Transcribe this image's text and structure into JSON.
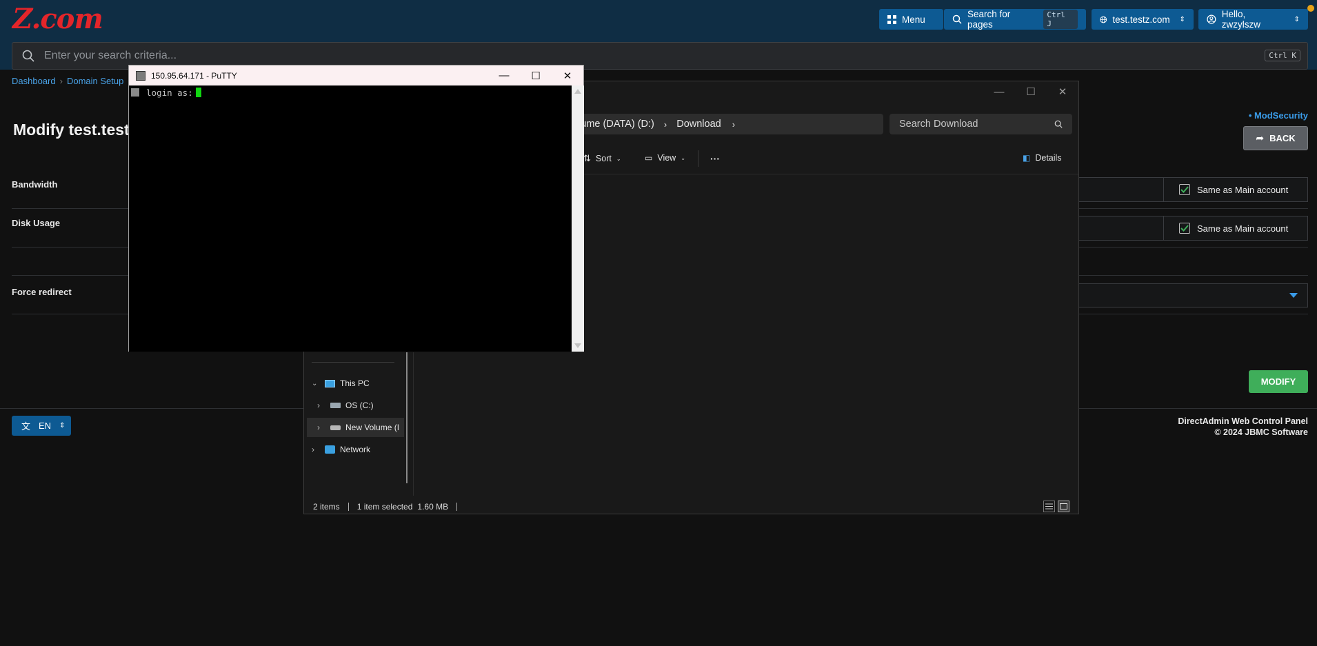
{
  "header": {
    "logo": "Z.com",
    "menu_label": "Menu",
    "search_pages_label": "Search for pages",
    "search_pages_shortcut": "Ctrl J",
    "domain_label": "test.testz.com",
    "user_label": "Hello, zwzylszw"
  },
  "search": {
    "placeholder": "Enter your search criteria...",
    "shortcut": "Ctrl K"
  },
  "breadcrumb": [
    "Dashboard",
    "Domain Setup"
  ],
  "page": {
    "title": "Modify test.test",
    "modsecurity_link": "• ModSecurity",
    "back_label": "BACK",
    "modify_label": "MODIFY"
  },
  "form": {
    "bandwidth_label": "Bandwidth",
    "disk_usage_label": "Disk Usage",
    "force_redirect_label": "Force redirect",
    "same_as_main": "Same as Main account"
  },
  "footer": {
    "lang": "EN",
    "line1": "DirectAdmin Web Control Panel",
    "line2": "© 2024 JBMC Software"
  },
  "explorer": {
    "address": [
      "olume (DATA) (D:)",
      "Download"
    ],
    "search_placeholder": "Search Download",
    "sort_label": "Sort",
    "view_label": "View",
    "more_label": "···",
    "details_label": "Details",
    "nav": {
      "this_pc": "This PC",
      "os_c": "OS (C:)",
      "new_volume": "New Volume (I",
      "network": "Network"
    },
    "status": {
      "items": "2 items",
      "selected": "1 item selected",
      "size": "1.60 MB"
    }
  },
  "putty": {
    "title": "150.95.64.171 - PuTTY",
    "prompt": "login as:"
  },
  "colors": {
    "topbar": "#0f2d44",
    "accent_blue": "#0d5a93",
    "logo_red": "#e4252a",
    "modify_green": "#3fae5a",
    "cursor_green": "#11d611"
  }
}
